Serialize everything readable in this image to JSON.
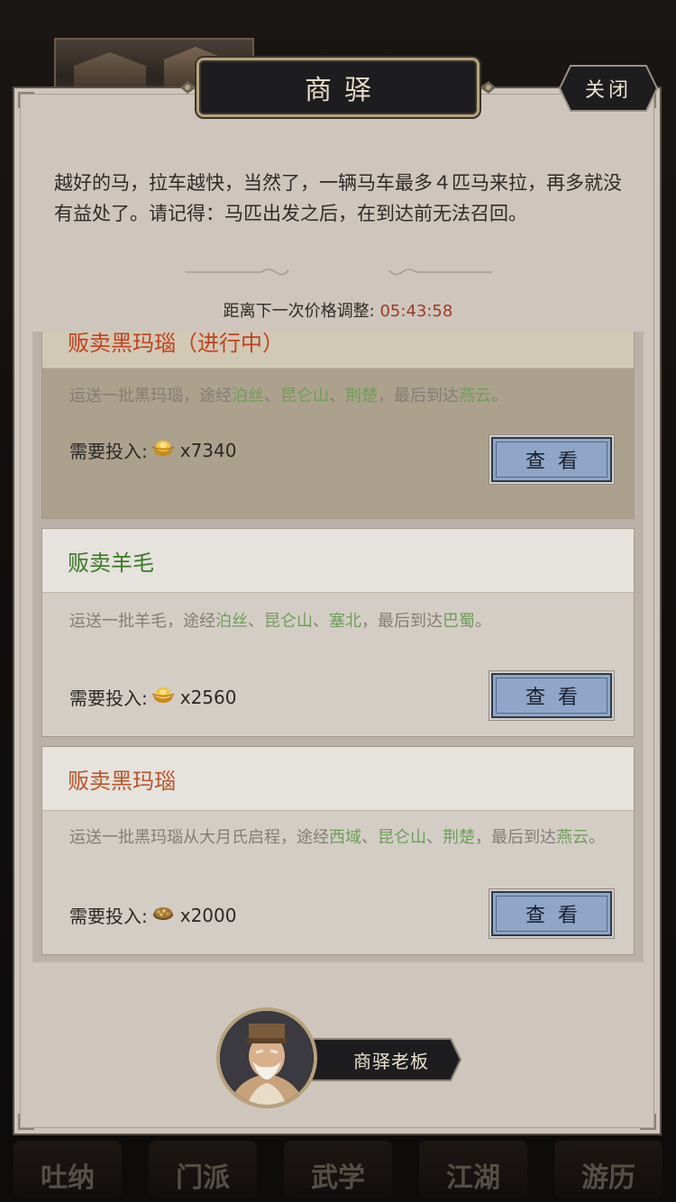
{
  "window": {
    "title": "商驿",
    "close_label": "关闭"
  },
  "intro_text": "越好的马，拉车越快，当然了，一辆马车最多４匹马来拉，再多就没有益处了。请记得：马匹出发之后，在到达前无法召回。",
  "timer": {
    "label": "距离下一次价格调整:",
    "value": "05:43:58"
  },
  "cards": [
    {
      "title": "贩卖黑玛瑙（进行中）",
      "desc_prefix": "运送一批黑玛瑙，途经",
      "places": [
        "泊丝",
        "昆仑山",
        "荆楚"
      ],
      "desc_mid": "，最后到达",
      "destination": "燕云",
      "desc_suffix": "。",
      "cost_label": "需要投入:",
      "cost_icon": "gold-ingot-icon",
      "cost_value": "x7340",
      "button_label": "查看"
    },
    {
      "title": "贩卖羊毛",
      "desc_prefix": "运送一批羊毛，途经",
      "places": [
        "泊丝",
        "昆仑山",
        "塞北"
      ],
      "desc_mid": "，最后到达",
      "destination": "巴蜀",
      "desc_suffix": "。",
      "cost_label": "需要投入:",
      "cost_icon": "gold-ingot-icon",
      "cost_value": "x2560",
      "button_label": "查看"
    },
    {
      "title": "贩卖黑玛瑙",
      "desc_prefix": "运送一批黑玛瑙从大月氏启程，途经",
      "places": [
        "西域",
        "昆仑山",
        "荆楚"
      ],
      "desc_mid": "，最后到达",
      "destination": "燕云",
      "desc_suffix": "。",
      "cost_label": "需要投入:",
      "cost_icon": "ore-icon",
      "cost_value": "x2000",
      "button_label": "查看"
    }
  ],
  "boss": {
    "name": "商驿老板"
  },
  "bottom_nav": [
    "吐纳",
    "门派",
    "武学",
    "江湖",
    "游历"
  ],
  "colors": {
    "panel_bg": "#cec6bd",
    "active_title": "#c0421f",
    "wool_title": "#3b7a26",
    "agate_title": "#b8562a",
    "place_green": "#6f9e58",
    "timer_red": "#9c3a24",
    "button_blue": "#8fa6c6"
  }
}
